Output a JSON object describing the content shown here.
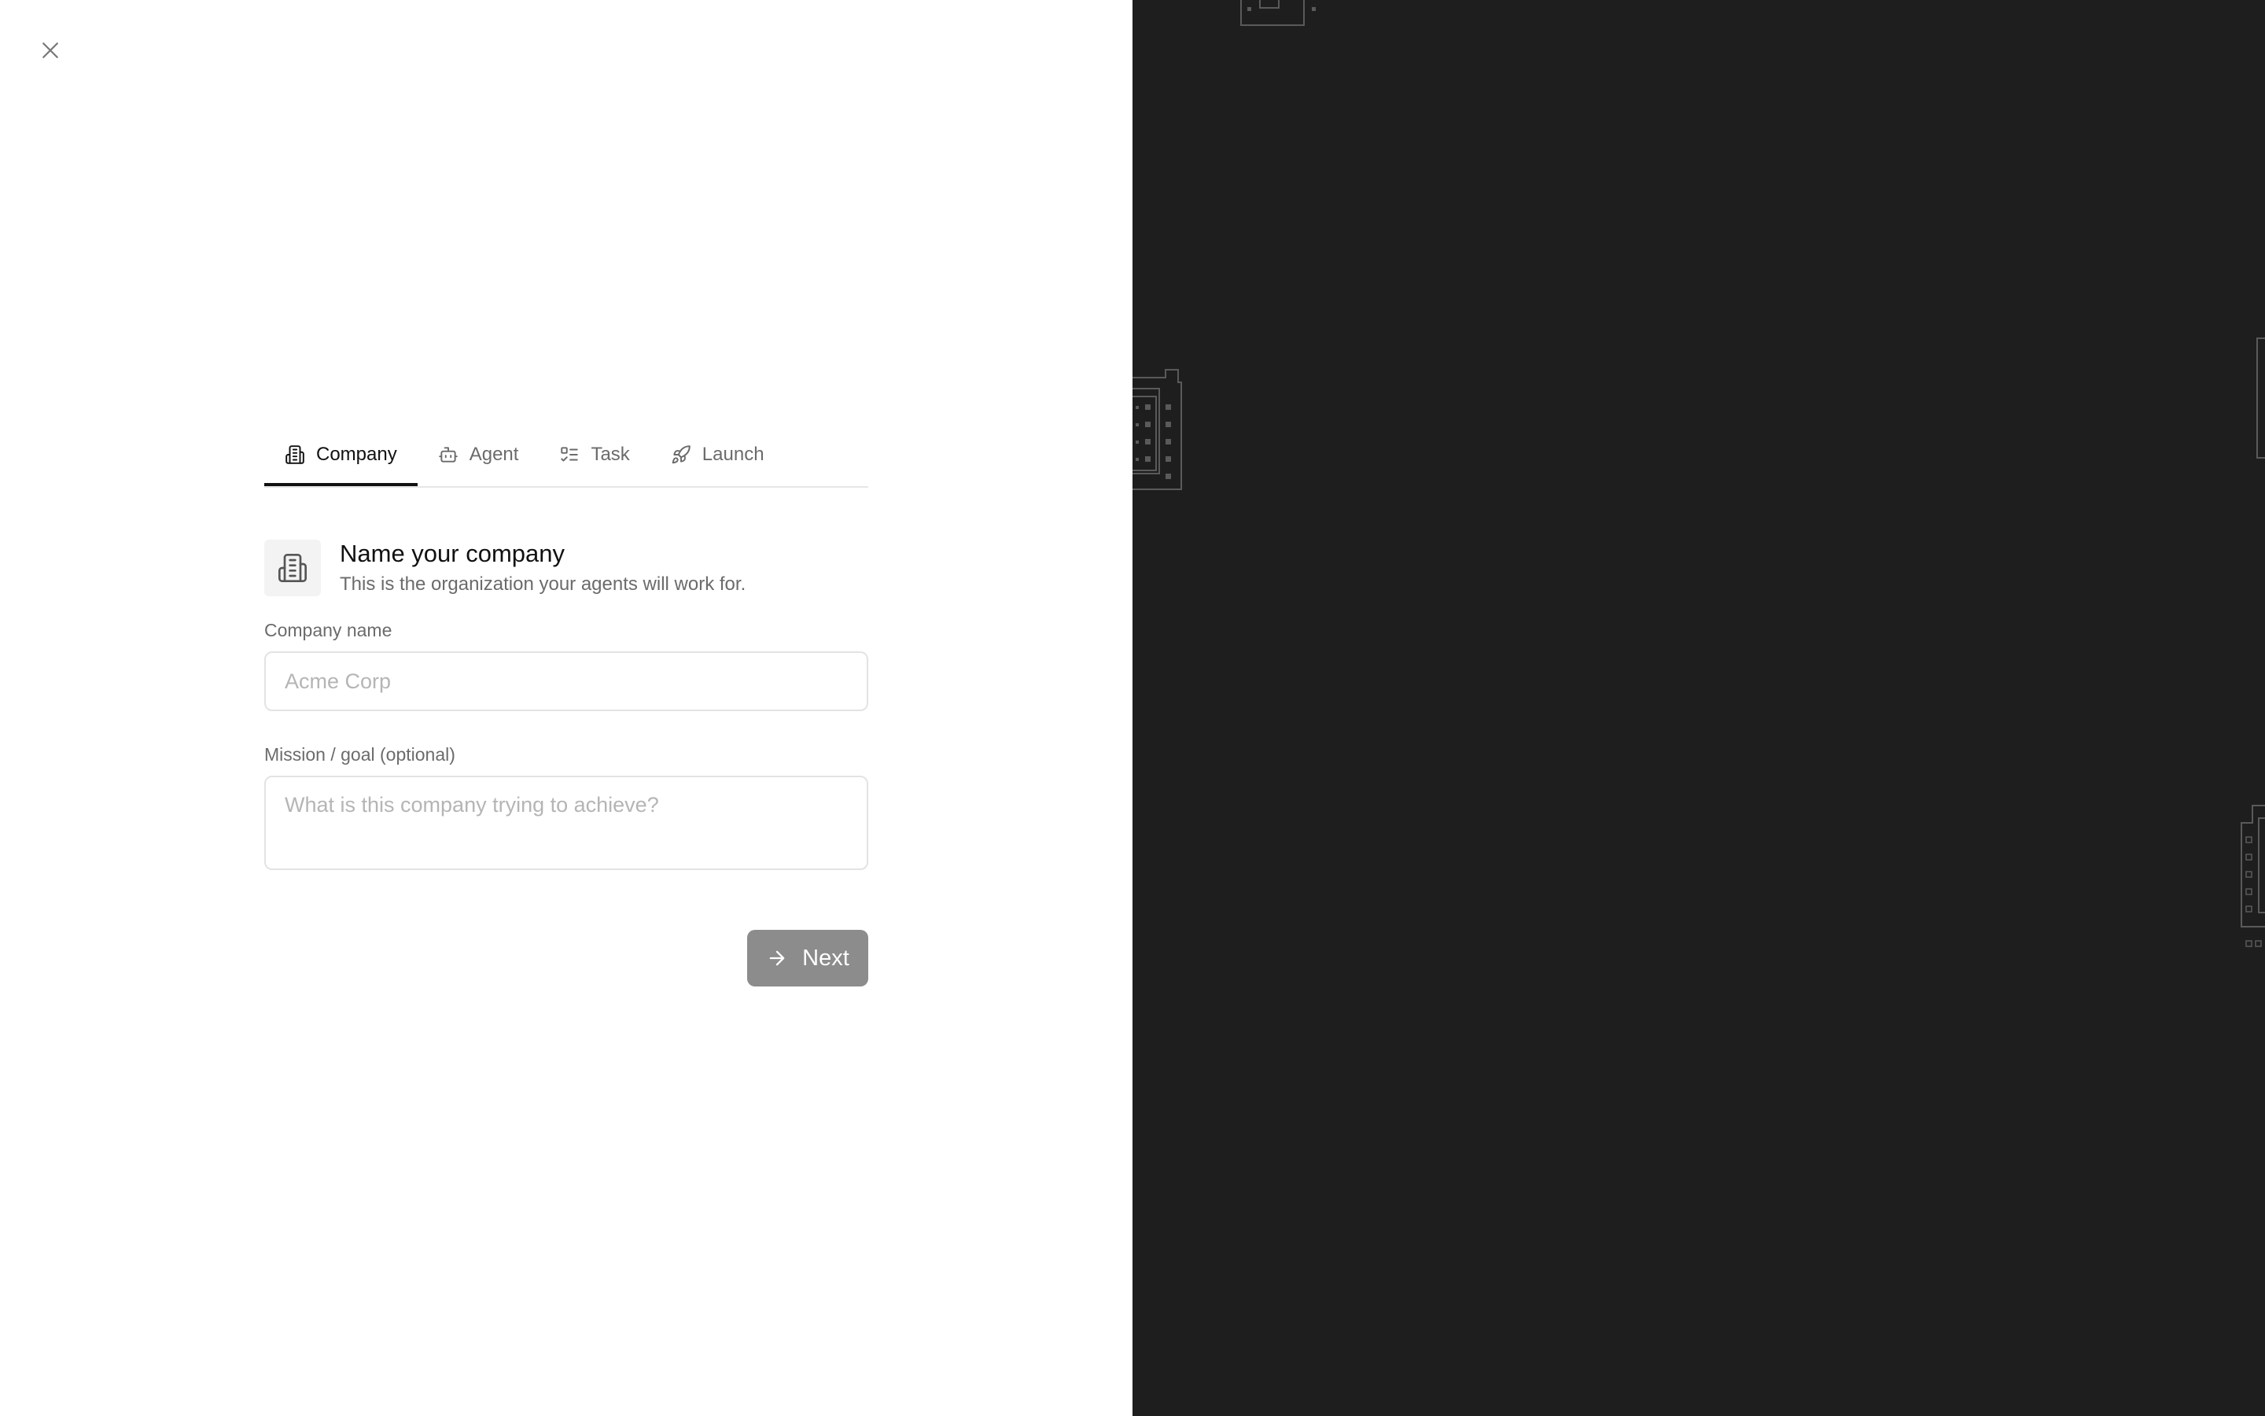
{
  "tabs": [
    {
      "label": "Company",
      "icon": "building-icon",
      "active": true
    },
    {
      "label": "Agent",
      "icon": "bot-icon",
      "active": false
    },
    {
      "label": "Task",
      "icon": "list-checks-icon",
      "active": false
    },
    {
      "label": "Launch",
      "icon": "rocket-icon",
      "active": false
    }
  ],
  "step": {
    "title": "Name your company",
    "subtitle": "This is the organization your agents will work for."
  },
  "form": {
    "company_name_label": "Company name",
    "company_name_placeholder": "Acme Corp",
    "company_name_value": "",
    "mission_label": "Mission / goal (optional)",
    "mission_placeholder": "What is this company trying to achieve?",
    "mission_value": ""
  },
  "actions": {
    "next_label": "Next"
  },
  "colors": {
    "active_tab": "#111111",
    "inactive_tab": "#6b6b6b",
    "next_button_bg": "#8c8c8c",
    "right_pane_bg": "#1e1e1e",
    "input_border": "#e3e3e3"
  }
}
